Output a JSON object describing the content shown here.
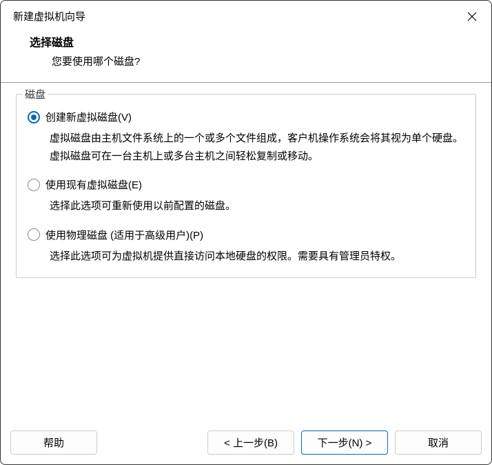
{
  "titlebar": {
    "title": "新建虚拟机向导"
  },
  "header": {
    "title": "选择磁盘",
    "subtitle": "您要使用哪个磁盘?"
  },
  "group": {
    "label": "磁盘",
    "options": [
      {
        "label": "创建新虚拟磁盘(V)",
        "description": "虚拟磁盘由主机文件系统上的一个或多个文件组成，客户机操作系统会将其视为单个硬盘。虚拟磁盘可在一台主机上或多台主机之间轻松复制或移动。",
        "selected": true
      },
      {
        "label": "使用现有虚拟磁盘(E)",
        "description": "选择此选项可重新使用以前配置的磁盘。",
        "selected": false
      },
      {
        "label": "使用物理磁盘 (适用于高级用户)(P)",
        "description": "选择此选项可为虚拟机提供直接访问本地硬盘的权限。需要具有管理员特权。",
        "selected": false
      }
    ]
  },
  "buttons": {
    "help": "帮助",
    "back": "< 上一步(B)",
    "next": "下一步(N) >",
    "cancel": "取消"
  }
}
